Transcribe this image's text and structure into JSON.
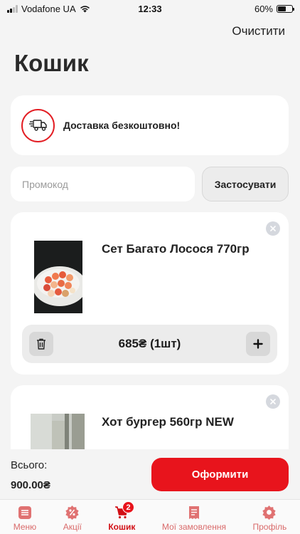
{
  "status_bar": {
    "carrier": "Vodafone UA",
    "time": "12:33",
    "battery": "60%",
    "battery_level": 0.6
  },
  "header": {
    "clear_label": "Очистити",
    "title": "Кошик"
  },
  "delivery": {
    "icon": "truck-icon",
    "text": "Доставка безкоштовно!"
  },
  "promo": {
    "placeholder": "Промокод",
    "value": "",
    "apply_label": "Застосувати"
  },
  "cart_items": [
    {
      "title": "Сет Багато Лосося 770гр",
      "price_qty": "685₴  (1шт)"
    },
    {
      "title": "Хот бургер 560гр NEW"
    }
  ],
  "checkout": {
    "total_label": "Всього:",
    "total_value": "900.00₴",
    "button_label": "Оформити"
  },
  "nav": {
    "items": [
      {
        "label": "Меню",
        "icon": "menu-icon"
      },
      {
        "label": "Акції",
        "icon": "percent-icon"
      },
      {
        "label": "Кошик",
        "icon": "cart-icon",
        "badge": "2",
        "active": true
      },
      {
        "label": "Мої замовлення",
        "icon": "receipt-icon"
      },
      {
        "label": "Профіль",
        "icon": "profile-icon"
      }
    ]
  },
  "colors": {
    "accent": "#e8141c",
    "background": "#f4f4f4",
    "card": "#ffffff"
  }
}
